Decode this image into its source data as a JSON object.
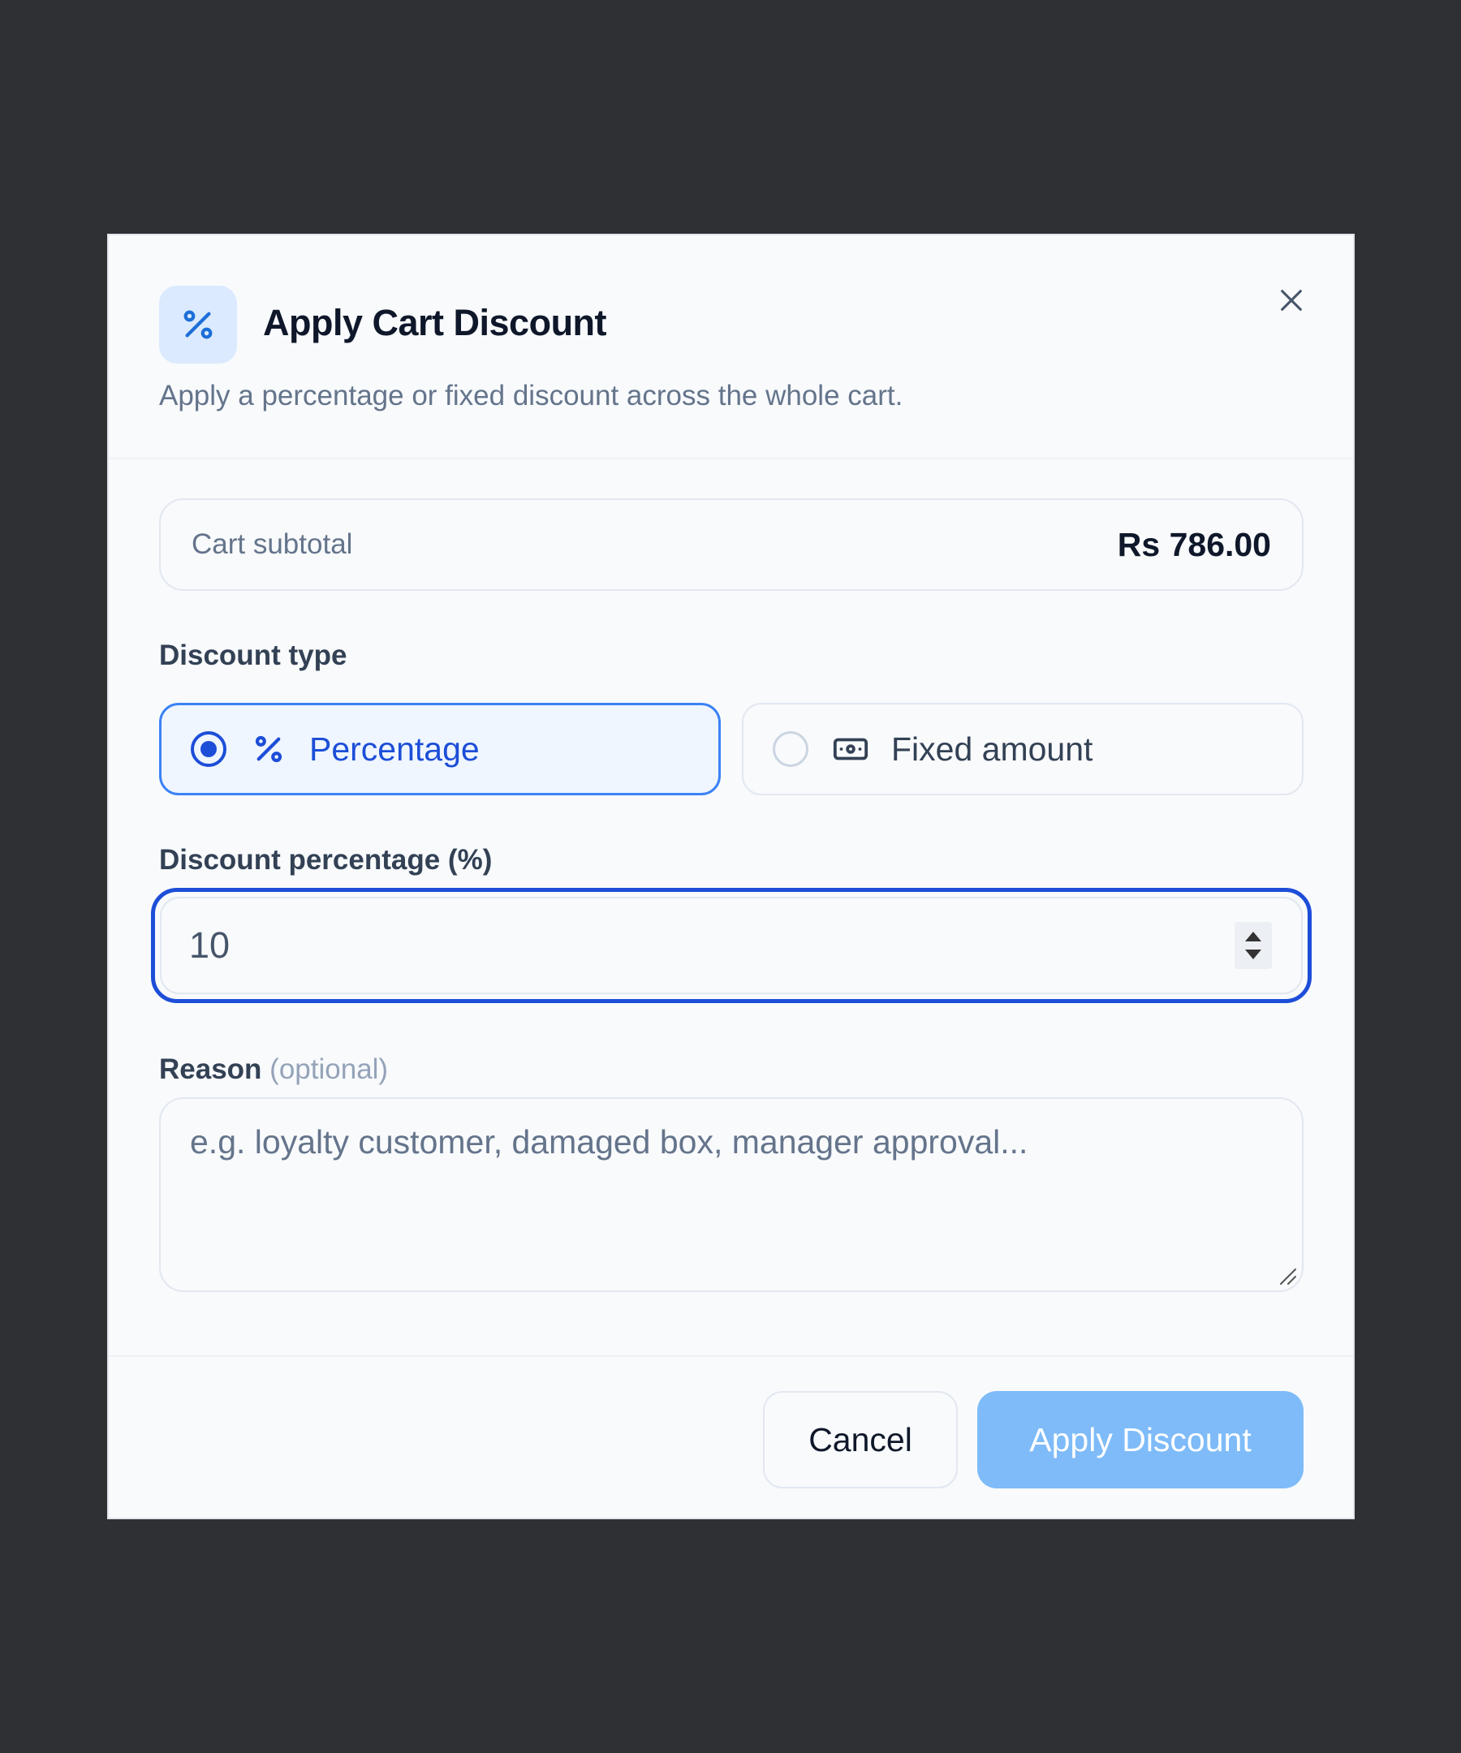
{
  "dialog": {
    "title": "Apply Cart Discount",
    "subtitle": "Apply a percentage or fixed discount across the whole cart.",
    "icon": "percent-icon",
    "close_icon": "close-icon"
  },
  "summary": {
    "label": "Cart subtotal",
    "value": "Rs 786.00"
  },
  "discount_type": {
    "label": "Discount type",
    "options": [
      {
        "label": "Percentage",
        "icon": "percent-icon",
        "selected": true
      },
      {
        "label": "Fixed amount",
        "icon": "banknote-icon",
        "selected": false
      }
    ]
  },
  "discount_value": {
    "label": "Discount percentage (%)",
    "value": "10"
  },
  "reason": {
    "label": "Reason",
    "optional": "(optional)",
    "placeholder": "e.g. loyalty customer, damaged box, manager approval..."
  },
  "footer": {
    "cancel_label": "Cancel",
    "apply_label": "Apply Discount"
  },
  "colors": {
    "accent": "#1d4ed8",
    "apply_button": "#7ebbf8",
    "backdrop": "#2f3033"
  }
}
